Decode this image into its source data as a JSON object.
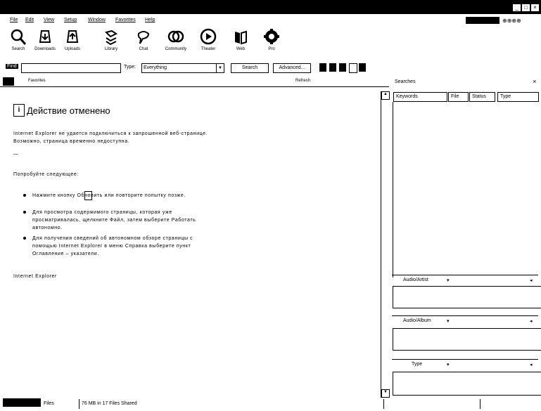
{
  "titlebar": {
    "title": ""
  },
  "menu": [
    "File",
    "Edit",
    "View",
    "Setup",
    "Window",
    "Favorites",
    "Help"
  ],
  "toolbar": {
    "buttons": [
      {
        "label": "Search",
        "icon": "magnifier-icon"
      },
      {
        "label": "Downloads",
        "icon": "downloads-icon"
      },
      {
        "label": "Uploads",
        "icon": "uploads-icon"
      },
      {
        "label": "Library",
        "icon": "library-icon"
      },
      {
        "label": "Chat",
        "icon": "chat-icon"
      },
      {
        "label": "Community",
        "icon": "community-icon"
      },
      {
        "label": "Theater",
        "icon": "theater-icon"
      },
      {
        "label": "Web",
        "icon": "web-icon"
      },
      {
        "label": "Pro",
        "icon": "pro-icon"
      }
    ]
  },
  "searchbar": {
    "find_label": "Find",
    "query": "",
    "type_label": "Type:",
    "type_value": "Everything",
    "search_button": "Search",
    "advanced_button": "Advanced..."
  },
  "addressbar": {
    "favorites_label": "Favorites",
    "refresh_label": "Refresh"
  },
  "error_page": {
    "title": "Действие отменено",
    "para1": "Internet Explorer не удается подключиться к запрошенной веб-странице. Возможно, страница временно недоступна.",
    "dash": "—",
    "try_label": "Попробуйте следующее:",
    "bullet1": "Нажмите кнопку   Обновить или повторите попытку позже.",
    "bullet2": "Для просмотра содержимого страницы, которая уже просматривалась, щелкните Файл, затем выберите Работать автономно.",
    "bullet3": "Для получения сведений об автономном обзоре страницы с помощью Internet Explorer в меню Справка выберите пункт Оглавление – указатели.",
    "footer": "Internet Explorer"
  },
  "right_panel": {
    "header": "Searches",
    "columns": [
      "Keywords",
      "File",
      "Status",
      "Type"
    ],
    "filters": [
      {
        "label": "Audio/Artist"
      },
      {
        "label": "Audio/Album"
      },
      {
        "label": "Type"
      }
    ]
  },
  "statusbar": {
    "left": "Files",
    "shared": "76 MB in 17 Files Shared"
  }
}
